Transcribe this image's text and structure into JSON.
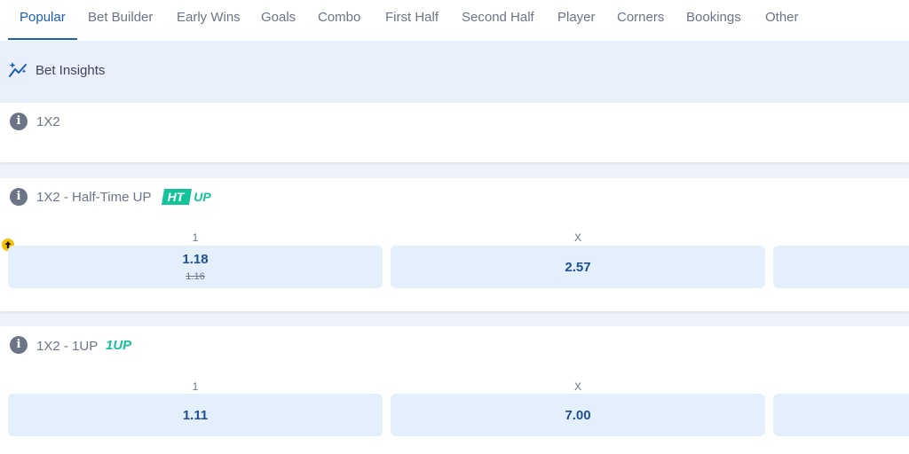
{
  "tabs": [
    {
      "label": "Popular",
      "active": true
    },
    {
      "label": "Bet Builder"
    },
    {
      "label": "Early Wins"
    },
    {
      "label": "Goals"
    },
    {
      "label": "Combo"
    },
    {
      "label": "First Half"
    },
    {
      "label": "Second Half"
    },
    {
      "label": "Player"
    },
    {
      "label": "Corners"
    },
    {
      "label": "Bookings"
    },
    {
      "label": "Other"
    }
  ],
  "insights": {
    "label": "Bet Insights"
  },
  "markets": [
    {
      "title": "1X2"
    },
    {
      "title": "1X2 - Half-Time UP",
      "badge": "HT UP",
      "selections": [
        {
          "label": "1",
          "odds": "1.18",
          "previous_odds": "1.16",
          "trend": "up-arrow-icon"
        },
        {
          "label": "X",
          "odds": "2.57"
        }
      ]
    },
    {
      "title": "1X2 - 1UP",
      "badge": "1UP",
      "selections": [
        {
          "label": "1",
          "odds": "1.11"
        },
        {
          "label": "X",
          "odds": "7.00"
        }
      ]
    }
  ],
  "colors": {
    "accent": "#1d5eb8",
    "odds_button_bg": "#e3effb",
    "badge_green": "#15c39a",
    "up_indicator": "#f6c000"
  }
}
